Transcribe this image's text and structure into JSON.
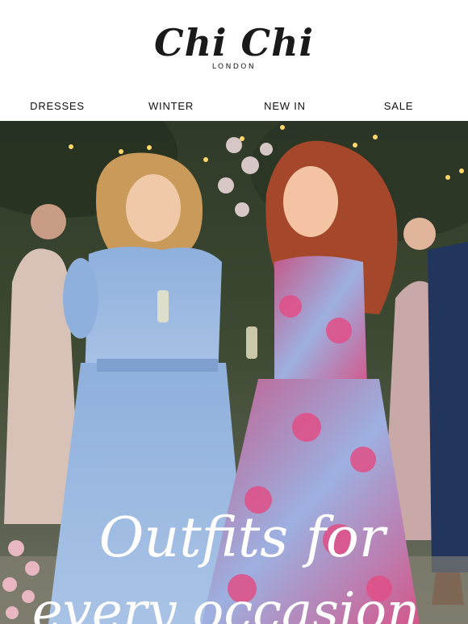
{
  "brand": {
    "name": "Chi Chi",
    "tagline": "LONDON"
  },
  "nav": {
    "items": [
      {
        "label": "DRESSES"
      },
      {
        "label": "WINTER"
      },
      {
        "label": "NEW IN"
      },
      {
        "label": "SALE"
      }
    ]
  },
  "hero": {
    "headline_line1": "Outfits for",
    "headline_line2": "every occasion",
    "image_description_icon": "party-photo"
  },
  "colors": {
    "text": "#111111",
    "background": "#ffffff",
    "hero_text": "#ffffff"
  }
}
